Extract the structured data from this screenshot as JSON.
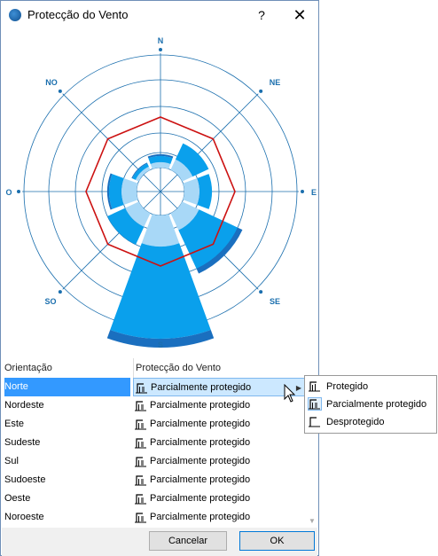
{
  "window": {
    "title": "Protecção do Vento",
    "help": "?",
    "close": "✕"
  },
  "rose": {
    "directions": {
      "N": "N",
      "NE": "NE",
      "E": "E",
      "SE": "SE",
      "S": "S",
      "SO": "SO",
      "O": "O",
      "NO": "NO"
    },
    "colors": {
      "grid": "#1b6fae",
      "light": "#a8d8f7",
      "medium": "#0aa0ec",
      "dark": "#1a6fbf",
      "outline": "#cc1111"
    }
  },
  "table": {
    "headers": {
      "orientation": "Orientação",
      "protection": "Protecção do Vento"
    },
    "rows": [
      {
        "orientation": "Norte",
        "protection": "Parcialmente protegido",
        "selected": true
      },
      {
        "orientation": "Nordeste",
        "protection": "Parcialmente protegido"
      },
      {
        "orientation": "Este",
        "protection": "Parcialmente protegido"
      },
      {
        "orientation": "Sudeste",
        "protection": "Parcialmente protegido"
      },
      {
        "orientation": "Sul",
        "protection": "Parcialmente protegido"
      },
      {
        "orientation": "Sudoeste",
        "protection": "Parcialmente protegido"
      },
      {
        "orientation": "Oeste",
        "protection": "Parcialmente protegido"
      },
      {
        "orientation": "Noroeste",
        "protection": "Parcialmente protegido"
      }
    ]
  },
  "popup": {
    "items": [
      {
        "label": "Protegido",
        "icon": "protected-icon"
      },
      {
        "label": "Parcialmente protegido",
        "icon": "partially-protected-icon",
        "highlighted": true
      },
      {
        "label": "Desprotegido",
        "icon": "unprotected-icon"
      }
    ]
  },
  "buttons": {
    "cancel": "Cancelar",
    "ok": "OK"
  }
}
